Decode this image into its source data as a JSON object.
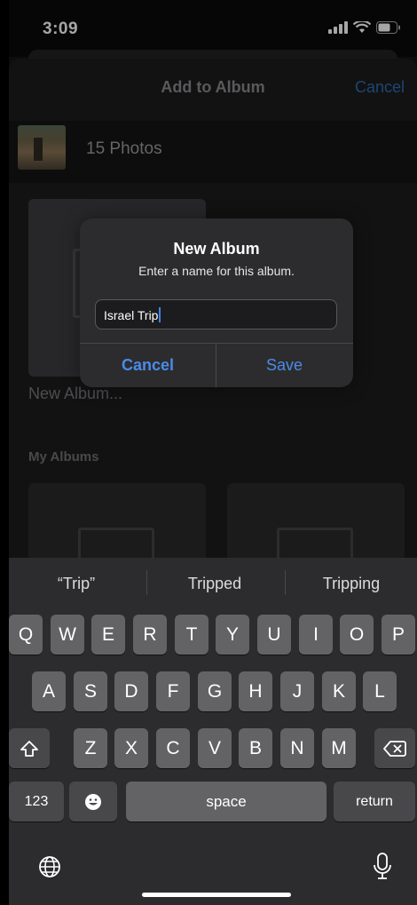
{
  "status_bar": {
    "time": "3:09"
  },
  "nav": {
    "title": "Add to Album",
    "cancel": "Cancel"
  },
  "selection": {
    "count_label": "15 Photos"
  },
  "albums": {
    "new_album_label": "New Album...",
    "section_title": "My Albums"
  },
  "alert": {
    "title": "New Album",
    "message": "Enter a name for this album.",
    "input_value": "Israel Trip",
    "cancel_label": "Cancel",
    "save_label": "Save"
  },
  "keyboard": {
    "suggestions": [
      "“Trip”",
      "Tripped",
      "Tripping"
    ],
    "row1": [
      "Q",
      "W",
      "E",
      "R",
      "T",
      "Y",
      "U",
      "I",
      "O",
      "P"
    ],
    "row2": [
      "A",
      "S",
      "D",
      "F",
      "G",
      "H",
      "J",
      "K",
      "L"
    ],
    "row3": [
      "Z",
      "X",
      "C",
      "V",
      "B",
      "N",
      "M"
    ],
    "numbers_label": "123",
    "space_label": "space",
    "return_label": "return"
  },
  "colors": {
    "accent": "#4a8be8",
    "background": "#1c1c1e",
    "key": "#636366"
  }
}
